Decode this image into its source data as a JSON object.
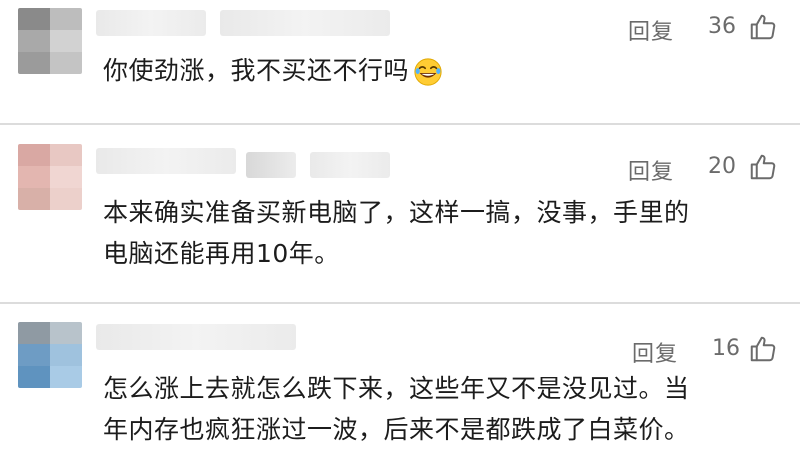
{
  "reply_label": "回复",
  "comments": [
    {
      "likes": "36",
      "text": "你使劲涨，我不买还不行吗",
      "emoji": "laughing-tears-emoji"
    },
    {
      "likes": "20",
      "text_line1": "本来确实准备买新电脑了，这样一搞，没事，手里的",
      "text_line2": "电脑还能再用10年。"
    },
    {
      "likes": "16",
      "text_line1": "怎么涨上去就怎么跌下来，这些年又不是没见过。当",
      "text_line2": "年内存也疯狂涨过一波，后来不是都跌成了白菜价。"
    }
  ],
  "colors": {
    "meta_text": "#6b6b6b",
    "divider": "#dcdcdc",
    "body_text": "#1c1c1c"
  }
}
